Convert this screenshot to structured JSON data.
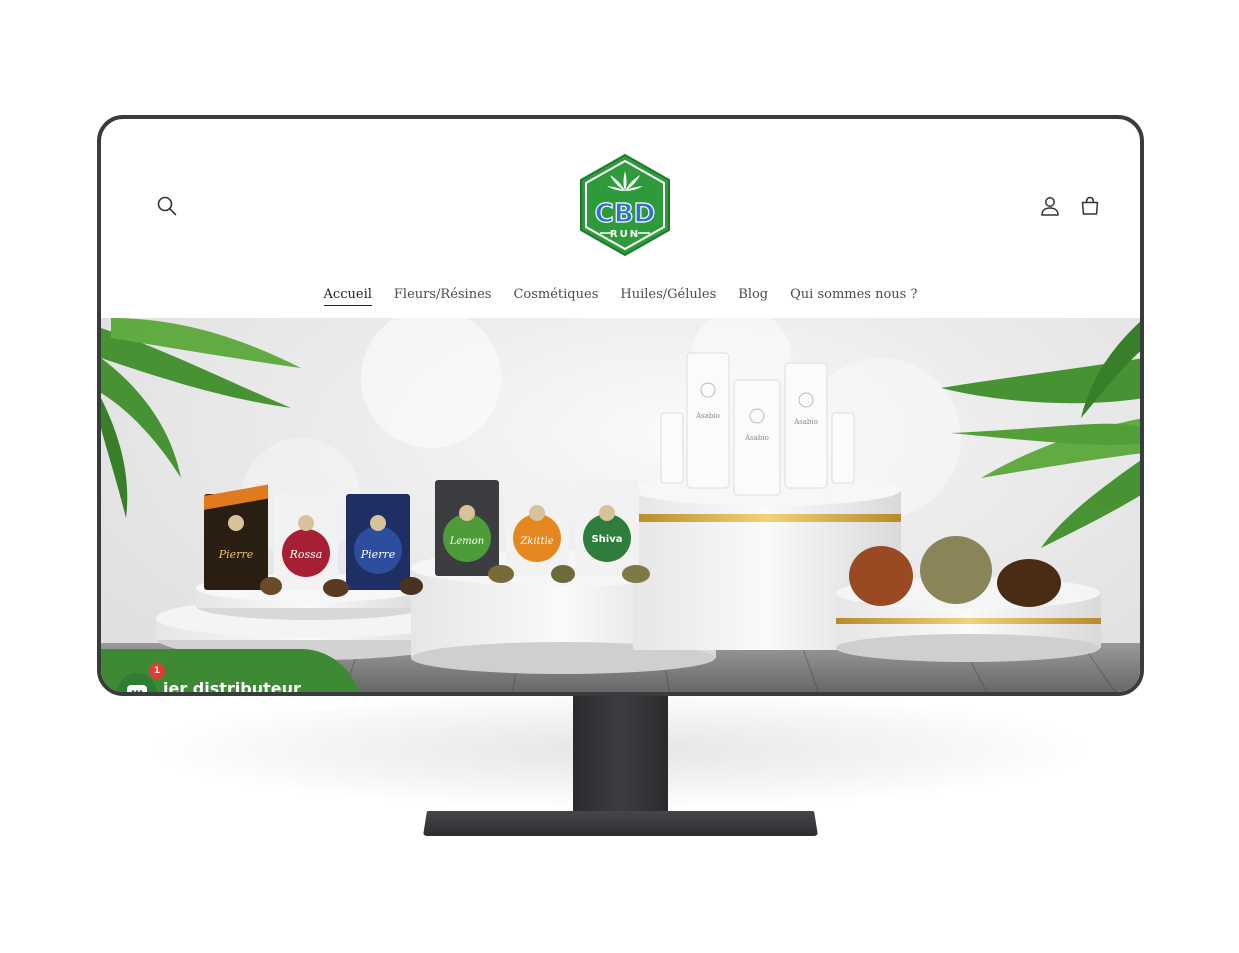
{
  "brand": {
    "logo_main": "CBD",
    "logo_sub": "RUN",
    "green": "#2e9a3c",
    "blue": "#2f6fd6"
  },
  "header": {
    "icons": [
      "search-icon",
      "account-icon",
      "cart-icon"
    ]
  },
  "nav": {
    "items": [
      "Accueil",
      "Fleurs/Résines",
      "Cosmétiques",
      "Huiles/Gélules",
      "Blog",
      "Qui sommes nous ?"
    ],
    "active": "Accueil"
  },
  "hero": {
    "products": {
      "bag1": "Pierre",
      "bag2": "Rossa",
      "bag3": "Pierre",
      "bag4": "Lemon",
      "bag5": "Zkittle",
      "bag6": "Shiva",
      "tube_brand": "Asabio"
    }
  },
  "promo": {
    "text": "ier distributeur",
    "badge": "1"
  }
}
